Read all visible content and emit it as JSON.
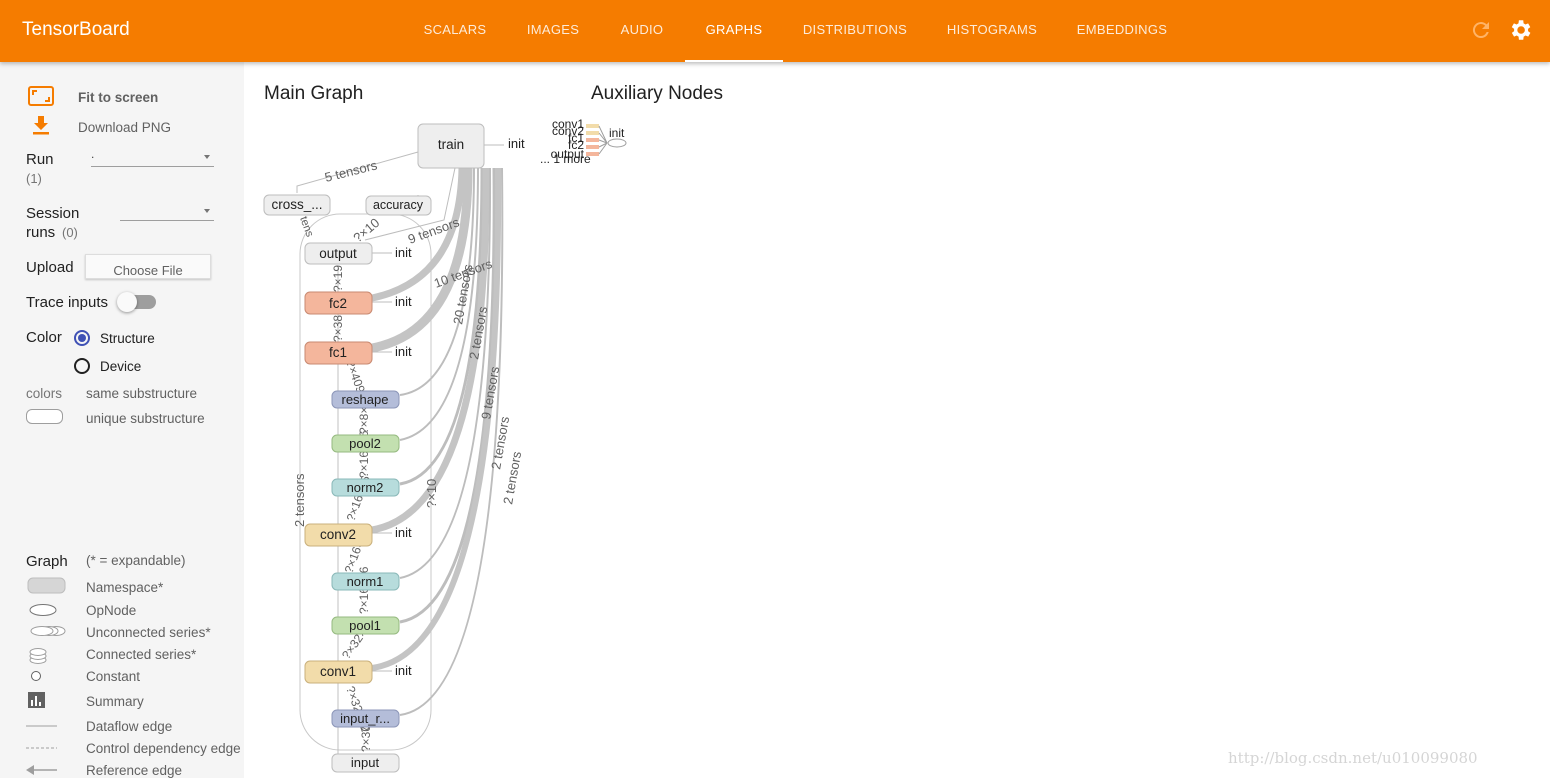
{
  "app": {
    "title": "TensorBoard"
  },
  "tabs": [
    {
      "label": "SCALARS"
    },
    {
      "label": "IMAGES"
    },
    {
      "label": "AUDIO"
    },
    {
      "label": "GRAPHS",
      "active": true
    },
    {
      "label": "DISTRIBUTIONS"
    },
    {
      "label": "HISTOGRAMS"
    },
    {
      "label": "EMBEDDINGS"
    }
  ],
  "colors": {
    "header": "#f57c00",
    "sidebar": "#f5f5f5",
    "structure_radio": "#3f51b5"
  },
  "sidebar": {
    "fit_label": "Fit to screen",
    "download_label": "Download PNG",
    "run_label": "Run",
    "run_count": "(1)",
    "run_value": ".",
    "session_label_1": "Session",
    "session_label_2": "runs",
    "session_count": "(0)",
    "session_value": "",
    "upload_label": "Upload",
    "choose_file": "Choose File",
    "trace_label": "Trace inputs",
    "trace_enabled": false,
    "color_label": "Color",
    "color_options": [
      {
        "label": "Structure",
        "selected": true
      },
      {
        "label": "Device",
        "selected": false
      }
    ],
    "colors_label": "colors",
    "same_sub": "same substructure",
    "unique_sub": "unique substructure",
    "graph_label": "Graph",
    "expandable_note": "(* = expandable)",
    "legend": [
      {
        "label": "Namespace*",
        "icon": "namespace-icon"
      },
      {
        "label": "OpNode",
        "icon": "opnode-icon"
      },
      {
        "label": "Unconnected series*",
        "icon": "unconnected-series-icon"
      },
      {
        "label": "Connected series*",
        "icon": "connected-series-icon"
      },
      {
        "label": "Constant",
        "icon": "constant-icon"
      },
      {
        "label": "Summary",
        "icon": "summary-icon"
      },
      {
        "label": "Dataflow edge",
        "icon": "dataflow-edge-icon"
      },
      {
        "label": "Control dependency edge",
        "icon": "control-edge-icon"
      },
      {
        "label": "Reference edge",
        "icon": "reference-edge-icon"
      }
    ]
  },
  "graph": {
    "main_title": "Main Graph",
    "aux_title": "Auxiliary Nodes",
    "nodes": {
      "train": "train",
      "cross": "cross_...",
      "accuracy": "accuracy",
      "output": "output",
      "fc2": "fc2",
      "fc1": "fc1",
      "reshape": "reshape",
      "pool2": "pool2",
      "norm2": "norm2",
      "conv2": "conv2",
      "norm1": "norm1",
      "pool1": "pool1",
      "conv1": "conv1",
      "input_r": "input_r...",
      "input": "input"
    },
    "init_label": "init",
    "edge_labels": {
      "five_tensors": "5 tensors",
      "nine_tensors": "9 tensors",
      "ten_tensors": "10 tensors",
      "twenty_tensors": "20 tensors",
      "two_tensors": "2 tensors",
      "two_x_ten": "?×10",
      "two_x_ten_b": "?×10",
      "fc2_out": "?×19",
      "fc1_fc2": "?×38",
      "reshape_fc1": "?×4096",
      "pool2_reshape": "?×8×8×",
      "norm2_pool2": "?×16×16",
      "conv2_norm2": "?×16×16",
      "norm1_conv2": "?×16×16",
      "pool1_norm1": "?×16×16",
      "conv1_pool1": "?×32×32",
      "inputr_conv1": "?×32×32",
      "input_inputr": "?×3072",
      "tens_small": "tens"
    },
    "aux": {
      "items": [
        "conv1",
        "conv2",
        "fc1",
        "fc2",
        "output"
      ],
      "more": "... 1 more",
      "init": "init"
    }
  },
  "watermark": "http://blog.csdn.net/u010099080"
}
